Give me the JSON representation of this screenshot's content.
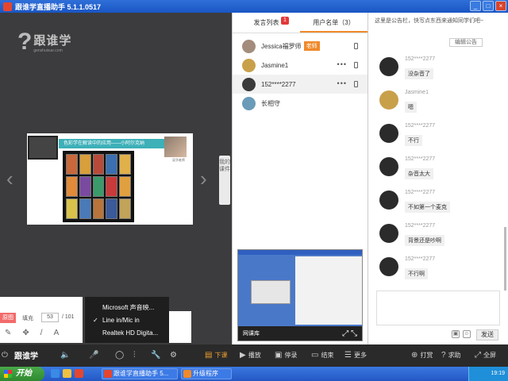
{
  "window": {
    "title": "跟谁学直播助手 5.1.1.0517",
    "controls": [
      "_",
      "□",
      "×"
    ]
  },
  "logo": {
    "mark": "?",
    "name_cn": "跟谁学",
    "name_en": "genshuixue.com"
  },
  "slide": {
    "title": "色彩学在解读中的应用——小阿尔克纳",
    "portrait_caption": "吴华老师"
  },
  "side_tab": {
    "label": "我的课件"
  },
  "fill_panel": {
    "tag": "原图",
    "fill_label": "填充",
    "page_current": "53",
    "page_total": "/ 101"
  },
  "mic_menu": {
    "items": [
      {
        "label": "Microsoft 声音映...",
        "checked": false
      },
      {
        "label": "Line in/Mic in",
        "checked": true
      },
      {
        "label": "Realtek HD Digita...",
        "checked": false
      }
    ]
  },
  "tabs": [
    {
      "label": "发言列表",
      "badge": "1",
      "active": false
    },
    {
      "label": "用户名单（3）",
      "badge": "",
      "active": true
    }
  ],
  "users": [
    {
      "name": "Jessica福罗师",
      "role": "老师",
      "avatar_color": "#a38c7c",
      "selected": false
    },
    {
      "name": "Jasmine1",
      "role": "",
      "avatar_color": "#c9a04a",
      "selected": false
    },
    {
      "name": "152****2277",
      "role": "",
      "avatar_color": "#3a3a3a",
      "selected": true
    },
    {
      "name": "长相守",
      "role": "",
      "avatar_color": "#6a9bb8",
      "selected": false
    }
  ],
  "video": {
    "label": "网课库"
  },
  "chat": {
    "notice": "这里是公告栏，快写点东西来通知同学们吧~",
    "edit_notice": "编辑公告",
    "messages": [
      {
        "user": "152****2277",
        "text": "没杂音了"
      },
      {
        "user": "Jasmine1",
        "text": "嗯"
      },
      {
        "user": "152****2277",
        "text": "不行"
      },
      {
        "user": "152****2277",
        "text": "杂音太大"
      },
      {
        "user": "152****2277",
        "text": "不如第一个麦克"
      },
      {
        "user": "152****2277",
        "text": "背景还是吵啊"
      },
      {
        "user": "152****2277",
        "text": "不行啊"
      }
    ],
    "send_label": "发送"
  },
  "toolbar": {
    "brand": "跟谁学",
    "end_class": "下课",
    "play": "播放",
    "stop": "停录",
    "finish": "结束",
    "more": "更多",
    "punch": "打赏",
    "help": "求助",
    "fullscreen": "全屏"
  },
  "taskbar": {
    "start": "开始",
    "tasks": [
      "跟谁学直播助手 5...",
      "升级程序"
    ],
    "clock": "19:19"
  }
}
